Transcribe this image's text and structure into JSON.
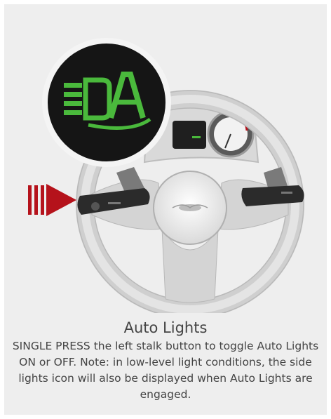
{
  "title": "Auto Lights",
  "description": "SINGLE PRESS the left stalk button to toggle Auto Lights ON or OFF.  Note: in low-level light conditions, the side lights icon will also be displayed when Auto Lights are engaged.",
  "icons": {
    "callout": "auto-lights-icon",
    "pointer": "red-arrow-icon"
  },
  "colors": {
    "background": "#eeeeee",
    "icon_green": "#4ab93c",
    "callout_bg": "#151515",
    "arrow_red": "#b5121b",
    "text": "#444444"
  }
}
